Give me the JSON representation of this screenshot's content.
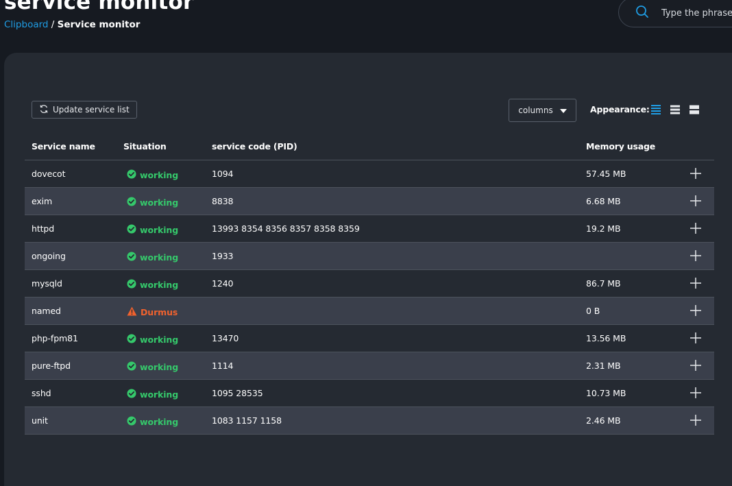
{
  "header": {
    "title": "service monitor",
    "breadcrumb": {
      "link": "Clipboard",
      "separator": "/",
      "current": "Service monitor"
    },
    "search": {
      "placeholder": "Type the phrase"
    }
  },
  "toolbar": {
    "update_label": "Update service list",
    "columns_label": "columns",
    "appearance_label": "Appearance:"
  },
  "table": {
    "columns": {
      "name": "Service name",
      "situation": "Situation",
      "pid": "service code (PID)",
      "memory": "Memory usage"
    },
    "rows": [
      {
        "name": "dovecot",
        "status": "working",
        "status_type": "ok",
        "pid": "1094",
        "memory": "57.45 MB"
      },
      {
        "name": "exim",
        "status": "working",
        "status_type": "ok",
        "pid": "8838",
        "memory": "6.68 MB"
      },
      {
        "name": "httpd",
        "status": "working",
        "status_type": "ok",
        "pid": "13993 8354 8356 8357 8358 8359",
        "memory": "19.2 MB"
      },
      {
        "name": "ongoing",
        "status": "working",
        "status_type": "ok",
        "pid": "1933",
        "memory": ""
      },
      {
        "name": "mysqld",
        "status": "working",
        "status_type": "ok",
        "pid": "1240",
        "memory": "86.7 MB"
      },
      {
        "name": "named",
        "status": "Durmus",
        "status_type": "warn",
        "pid": "",
        "memory": "0 B"
      },
      {
        "name": "php-fpm81",
        "status": "working",
        "status_type": "ok",
        "pid": "13470",
        "memory": "13.56 MB"
      },
      {
        "name": "pure-ftpd",
        "status": "working",
        "status_type": "ok",
        "pid": "1114",
        "memory": "2.31 MB"
      },
      {
        "name": "sshd",
        "status": "working",
        "status_type": "ok",
        "pid": "1095 28535",
        "memory": "10.73 MB"
      },
      {
        "name": "unit",
        "status": "working",
        "status_type": "ok",
        "pid": "1083 1157 1158",
        "memory": "2.46 MB"
      }
    ]
  },
  "colors": {
    "accent": "#1f9ee6",
    "ok": "#35c96b",
    "warn": "#f0622e"
  }
}
